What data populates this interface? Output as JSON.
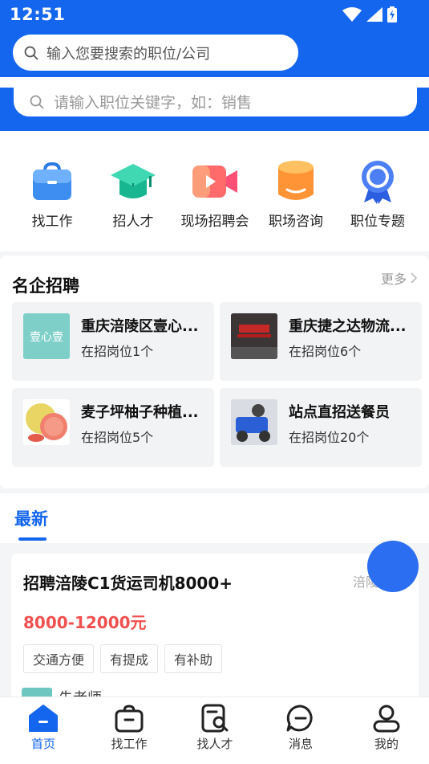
{
  "status_bar": {
    "time": "12:51",
    "icons": [
      "wifi-icon",
      "signal-icon",
      "battery-icon"
    ]
  },
  "search": {
    "placeholder_top": "输入您要搜索的职位/公司",
    "placeholder_second": "请输入职位关键字，如：销售"
  },
  "quick_menu": [
    {
      "label": "找工作",
      "icon": "briefcase-icon"
    },
    {
      "label": "招人才",
      "icon": "graduation-cap-icon"
    },
    {
      "label": "现场招聘会",
      "icon": "video-camera-icon"
    },
    {
      "label": "职场咨询",
      "icon": "database-icon"
    },
    {
      "label": "职位专题",
      "icon": "badge-icon"
    }
  ],
  "famous": {
    "title": "名企招聘",
    "more": "更多",
    "companies": [
      {
        "name": "重庆涪陵区壹心...",
        "count": "在招岗位1个",
        "thumb_text": "壹心壹"
      },
      {
        "name": "重庆捷之达物流...",
        "count": "在招岗位6个"
      },
      {
        "name": "麦子坪柚子种植...",
        "count": "在招岗位5个"
      },
      {
        "name": "站点直招送餐员",
        "count": "在招岗位20个"
      }
    ]
  },
  "latest": {
    "tab": "最新"
  },
  "job": {
    "title": "招聘涪陵C1货运司机8000+",
    "location": "涪陵",
    "salary": "8000-12000元",
    "tags": [
      "交通方便",
      "有提成",
      "有补助"
    ],
    "poster": "朱老师"
  },
  "tabbar": [
    {
      "label": "首页",
      "icon": "home-icon",
      "active": true
    },
    {
      "label": "找工作",
      "icon": "bag-icon"
    },
    {
      "label": "找人才",
      "icon": "search-person-icon"
    },
    {
      "label": "消息",
      "icon": "message-icon"
    },
    {
      "label": "我的",
      "icon": "user-icon"
    }
  ],
  "colors": {
    "primary": "#1466ee",
    "salary": "#f0504f",
    "fab": "#2c6ef2"
  }
}
